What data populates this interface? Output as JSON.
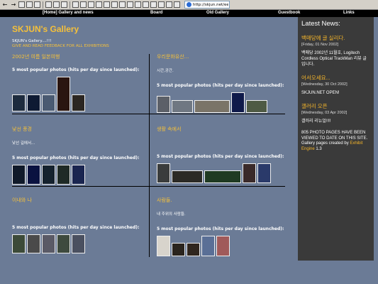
{
  "browser": {
    "address_value": "http://skjun.net/ee/"
  },
  "nav": {
    "items": [
      "[Home] Gallery and news",
      "Board",
      "Old Gallery",
      "Guestbook",
      "Links"
    ]
  },
  "site": {
    "title": "SKJUN's Gallery",
    "intro_line1": "SKJUN's Gallery....!!!",
    "intro_line2": "GIVE AND READ FEEDBACK FOR ALL EXHIBITIONS"
  },
  "popular_label": "5 most popular photos (hits per day since launched):",
  "galleries": [
    {
      "title": "2002년 여름 일본여행",
      "desc": ""
    },
    {
      "title": "우리문화유산...",
      "desc": "시간,공간."
    },
    {
      "title": "낯선 풍경",
      "desc": "낯선 길에서..."
    },
    {
      "title": "생활 속에서",
      "desc": ""
    },
    {
      "title": "이내와 나",
      "desc": ""
    },
    {
      "title": "사람들.",
      "desc": "내 주위의 사람들."
    }
  ],
  "sidebar": {
    "heading": "Latest News:",
    "news": [
      {
        "title": "백매당에 글 실리다.",
        "date": "[Friday, 01 Nov 2002]",
        "body": "백매당 2002년 11월호, Logitech Cordless Optical TrackMan 리뷰 글입니다."
      },
      {
        "title": "어서오세요...",
        "date": "[Wednesday, 30 Oct 2002]",
        "body": "SKJUN.NET OPEN!"
      },
      {
        "title": "갤러리 오픈",
        "date": "[Wednesday, 03 Apr 2002]",
        "body": "갤러리 리뉴얼!!!!"
      }
    ],
    "footer_text": "805 PHOTO PAGES HAVE BEEN VIEWED TO DATE ON THIS SITE. Gallery pages created by",
    "footer_link": "Exhibit Engine",
    "footer_version": "1.3"
  }
}
